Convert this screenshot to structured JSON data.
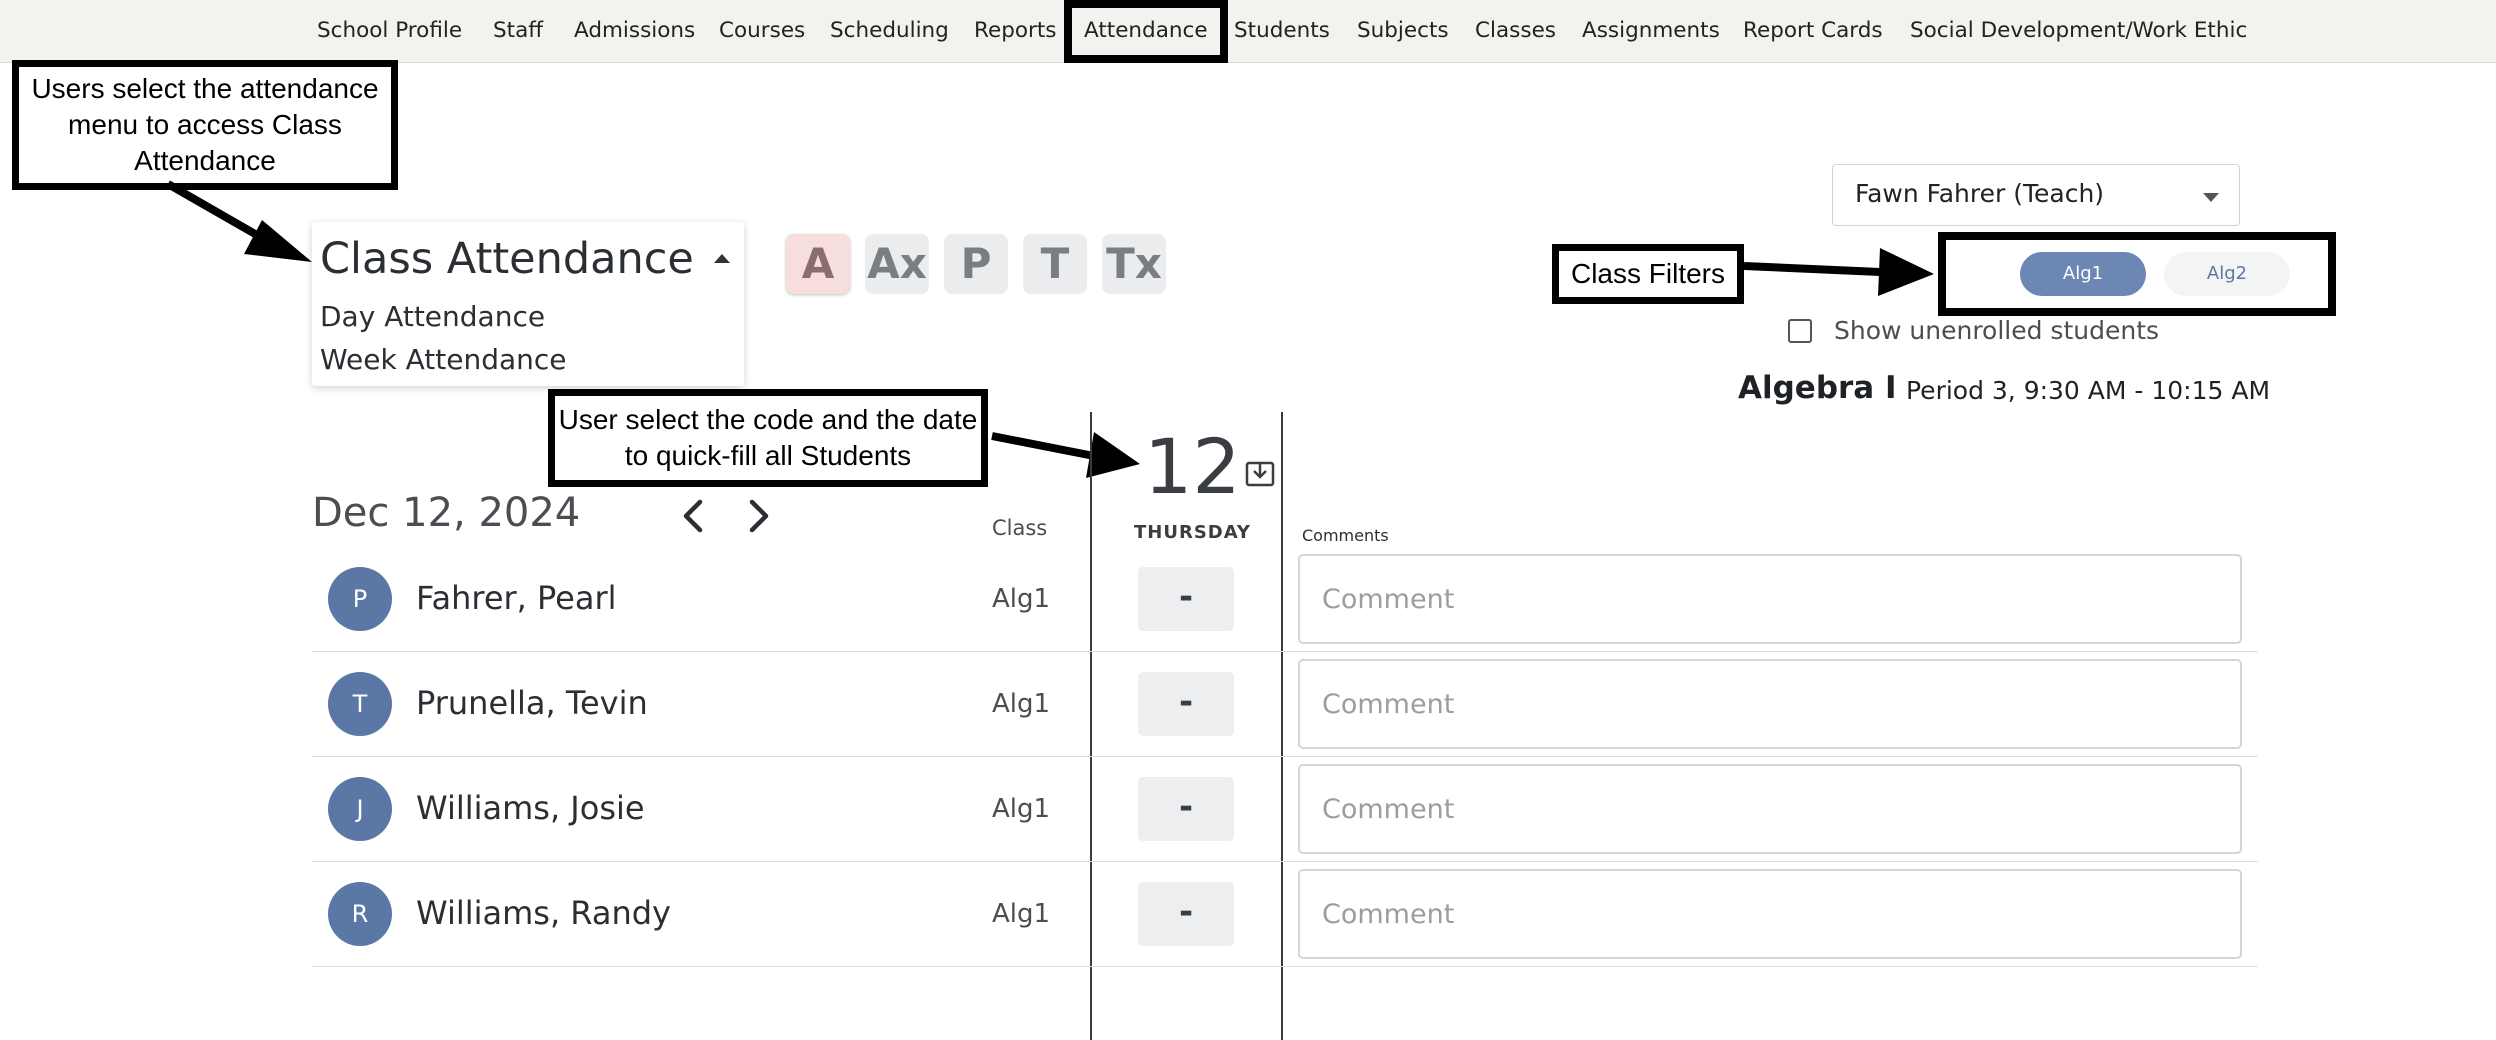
{
  "nav": {
    "items": [
      "School Profile",
      "Staff",
      "Admissions",
      "Courses",
      "Scheduling",
      "Reports",
      "Attendance",
      "Students",
      "Subjects",
      "Classes",
      "Assignments",
      "Report Cards",
      "Social Development/Work Ethic"
    ]
  },
  "annotations": {
    "menu_note": "Users select the attendance menu to access Class Attendance",
    "code_note": "User select the code and the date to quick-fill all Students",
    "filter_note": "Class Filters"
  },
  "attendance_menu": {
    "selected": "Class Attendance",
    "options": [
      "Day Attendance",
      "Week Attendance"
    ]
  },
  "codes": [
    "A",
    "Ax",
    "P",
    "T",
    "Tx"
  ],
  "teacher_select": {
    "value": "Fawn Fahrer (Teach)"
  },
  "class_filters": [
    "Alg1",
    "Alg2"
  ],
  "show_unenrolled": {
    "label": "Show unenrolled students",
    "checked": false
  },
  "class_info": {
    "name": "Algebra I",
    "period": "Period 3, 9:30 AM - 10:15 AM"
  },
  "grid": {
    "date": "Dec 12, 2024",
    "class_header": "Class",
    "day_number": "12",
    "day_name": "THURSDAY",
    "comments_header": "Comments",
    "comment_placeholder": "Comment"
  },
  "students": [
    {
      "initial": "P",
      "name": "Fahrer, Pearl",
      "class": "Alg1",
      "code": "-"
    },
    {
      "initial": "T",
      "name": "Prunella, Tevin",
      "class": "Alg1",
      "code": "-"
    },
    {
      "initial": "J",
      "name": "Williams, Josie",
      "class": "Alg1",
      "code": "-"
    },
    {
      "initial": "R",
      "name": "Williams, Randy",
      "class": "Alg1",
      "code": "-"
    }
  ],
  "colors": {
    "accent": "#6d87b5",
    "avatar": "#5b77a6",
    "selected_code_bg": "#f6dede"
  },
  "icons": [
    "caret-up-icon",
    "caret-down-icon",
    "chevron-left-icon",
    "chevron-right-icon",
    "quick-fill-download-icon",
    "checkbox-icon"
  ]
}
